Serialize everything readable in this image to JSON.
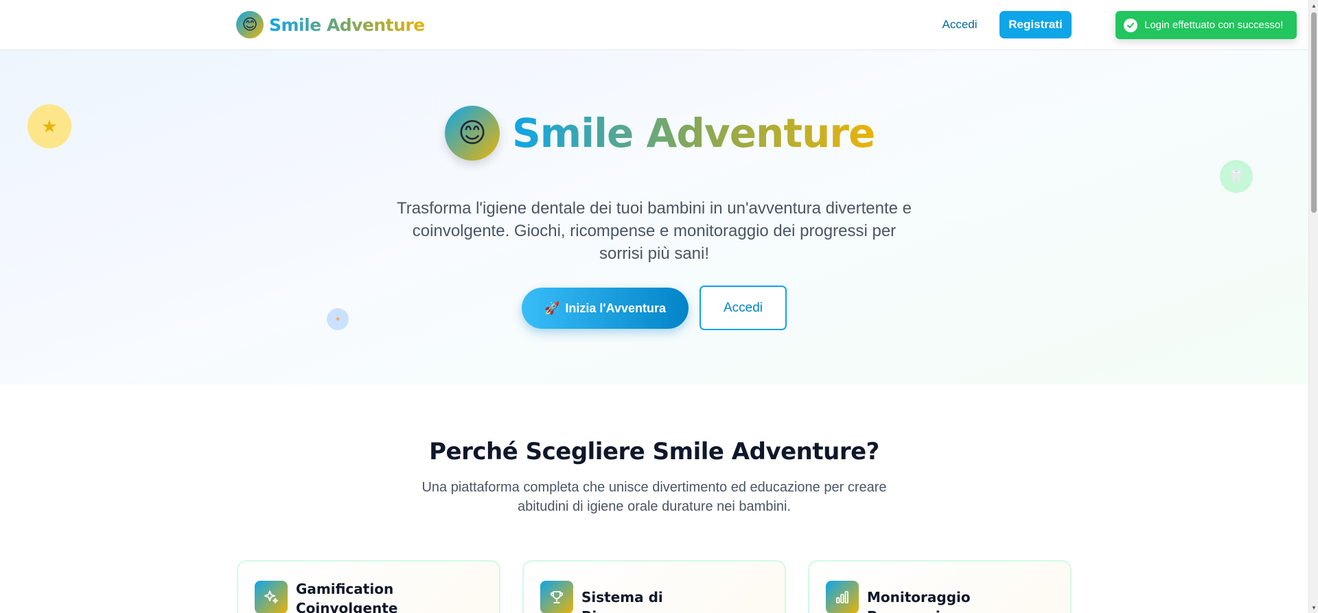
{
  "header": {
    "brand": {
      "logo_icon": "smile-face-icon",
      "name": "Smile Adventure"
    },
    "nav": {
      "login": "Accedi",
      "register": "Registrati"
    }
  },
  "toast": {
    "icon": "check-circle-icon",
    "message": "Login effettuato con successo!",
    "color": "#22c55e"
  },
  "hero": {
    "logo_icon": "smile-face-icon",
    "title": "Smile Adventure",
    "description": "Trasforma l'igiene dentale dei tuoi bambini in un'avventura divertente e coinvolgente. Giochi, ricompense e monitoraggio dei progressi per sorrisi più sani!",
    "cta_primary": {
      "icon": "rocket-icon",
      "label": "Inizia l'Avventura"
    },
    "cta_secondary": {
      "label": "Accedi"
    },
    "floating_icons": [
      "star-icon",
      "tooth-icon",
      "sparkle-icon"
    ]
  },
  "features": {
    "title": "Perché Scegliere Smile Adventure?",
    "subtitle": "Una piattaforma completa che unisce divertimento ed educazione per creare abitudini di igiene orale durature nei bambini.",
    "cards": [
      {
        "icon": "sparkles-icon",
        "title": "Gamification Coinvolgente"
      },
      {
        "icon": "trophy-icon",
        "title": "Sistema di Ricompense"
      },
      {
        "icon": "bar-chart-icon",
        "title": "Monitoraggio Progressi"
      }
    ]
  },
  "colors": {
    "primary": "#0ea5e9",
    "primary_dark": "#0284c7",
    "accent": "#eab308",
    "success": "#22c55e"
  }
}
